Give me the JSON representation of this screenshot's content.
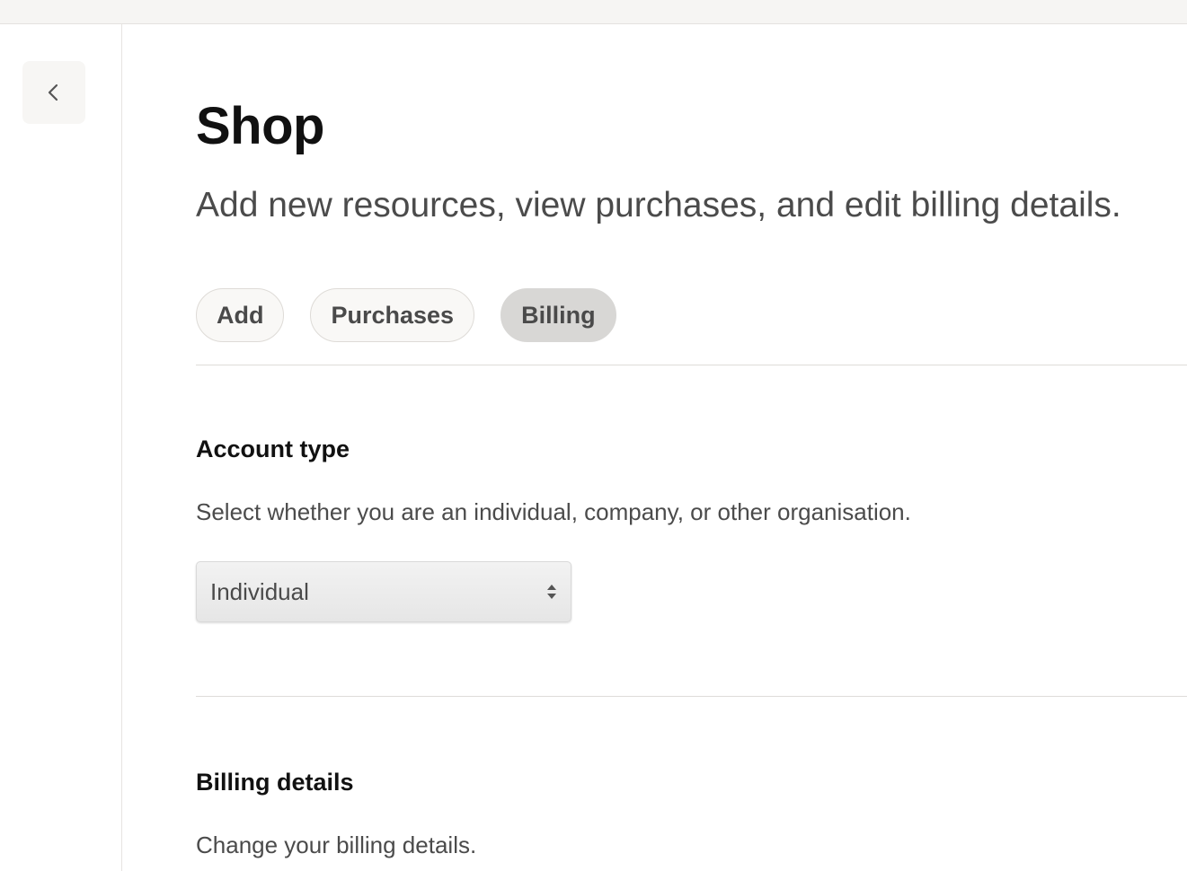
{
  "nav": {
    "back_icon": "chevron-left-icon"
  },
  "page": {
    "title": "Shop",
    "subtitle": "Add new resources, view purchases, and edit billing details."
  },
  "tabs": [
    {
      "label": "Add",
      "active": false
    },
    {
      "label": "Purchases",
      "active": false
    },
    {
      "label": "Billing",
      "active": true
    }
  ],
  "account_type": {
    "heading": "Account type",
    "description": "Select whether you are an individual, company, or other organisation.",
    "select_value": "Individual",
    "select_icon": "up-down-arrows-icon"
  },
  "billing_details": {
    "heading": "Billing details",
    "description": "Change your billing details."
  },
  "colors": {
    "active_tab_bg": "#d8d7d5",
    "inactive_tab_bg": "#f9f8f6",
    "heading_text": "#111111",
    "body_text": "#4b4b4b"
  }
}
